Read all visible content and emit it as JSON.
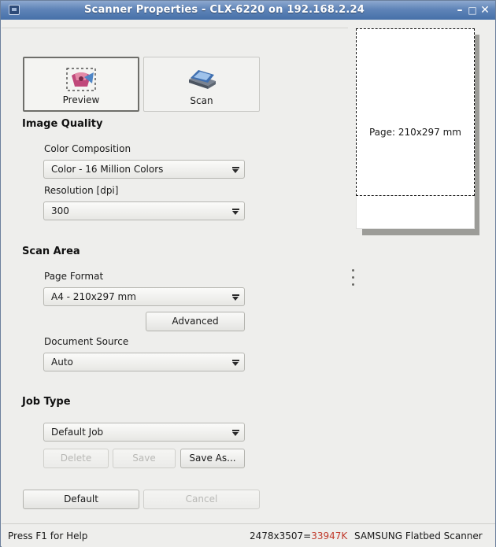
{
  "window": {
    "title": "Scanner Properties - CLX-6220 on 192.168.2.24"
  },
  "modes": {
    "preview_label": "Preview",
    "scan_label": "Scan"
  },
  "image_quality": {
    "heading": "Image Quality",
    "color_label": "Color Composition",
    "color_value": "Color - 16 Million Colors",
    "resolution_label": "Resolution [dpi]",
    "resolution_value": "300"
  },
  "scan_area": {
    "heading": "Scan Area",
    "page_format_label": "Page Format",
    "page_format_value": "A4 - 210x297 mm",
    "advanced_label": "Advanced",
    "doc_source_label": "Document Source",
    "doc_source_value": "Auto"
  },
  "job_type": {
    "heading": "Job Type",
    "value": "Default Job",
    "delete_label": "Delete",
    "save_label": "Save",
    "save_as_label": "Save As..."
  },
  "footer_buttons": {
    "default_label": "Default",
    "cancel_label": "Cancel"
  },
  "preview": {
    "page_label": "Page: 210x297 mm"
  },
  "status": {
    "help": "Press F1 for Help",
    "dimensions": "2478x3507=",
    "size": "33947K",
    "device": "SAMSUNG Flatbed Scanner"
  },
  "colors": {
    "titlebar": "#4670a8",
    "size_text": "#c0392b"
  }
}
